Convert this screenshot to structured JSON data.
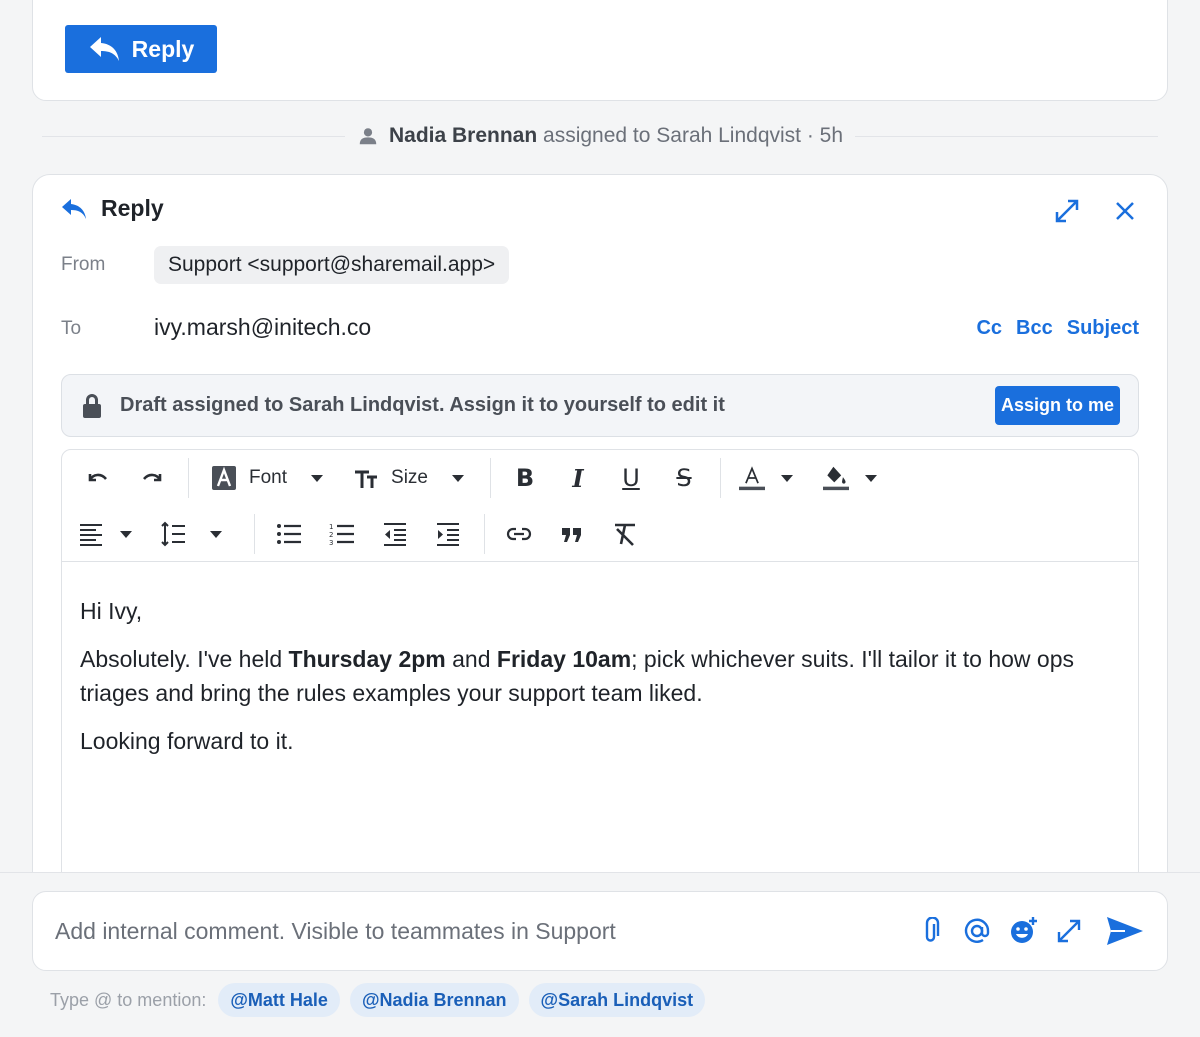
{
  "top_card": {
    "reply_label": "Reply"
  },
  "activity": {
    "actor": "Nadia Brennan",
    "action": "assigned to Sarah Lindqvist · 5h"
  },
  "compose": {
    "title": "Reply",
    "from_label": "From",
    "from_value": "Support <support@sharemail.app>",
    "to_label": "To",
    "to_value": "ivy.marsh@initech.co",
    "links": [
      "Cc",
      "Bcc",
      "Subject"
    ],
    "notice_text": "Draft assigned to Sarah Lindqvist. Assign it to yourself to edit it",
    "assign_label": "Assign to me",
    "toolbar": {
      "font_label": "Font",
      "size_label": "Size"
    },
    "body": {
      "greeting": "Hi Ivy,",
      "p1_a": "Absolutely. I've held ",
      "p1_b": "Thursday 2pm",
      "p1_c": " and ",
      "p1_d": "Friday 10am",
      "p1_e": "; pick whichever suits. I'll tailor it to how ops triages and bring the rules examples your support team liked.",
      "closing": "Looking forward to it."
    }
  },
  "comment": {
    "placeholder": "Add internal comment. Visible to teammates in Support",
    "mention_label": "Type @ to mention:",
    "mentions": [
      "@Matt Hale",
      "@Nadia Brennan",
      "@Sarah Lindqvist"
    ]
  },
  "colors": {
    "accent": "#1a6fdd",
    "page_bg": "#f4f5f6"
  }
}
